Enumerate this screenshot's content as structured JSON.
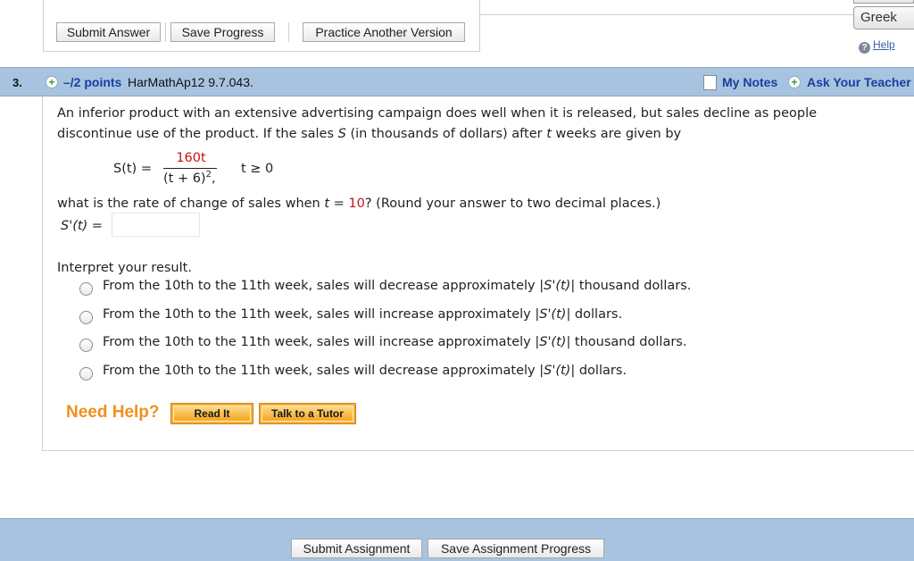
{
  "toolbar": {
    "submit_answer": "Submit Answer",
    "save_progress": "Save Progress",
    "practice_another": "Practice Another Version"
  },
  "language": {
    "selected": "Greek"
  },
  "help": {
    "label": "Help"
  },
  "question": {
    "number": "3.",
    "points": "–/2 points",
    "code": "HarMathAp12 9.7.043.",
    "my_notes": "My Notes",
    "ask_teacher": "Ask Your Teacher",
    "text_line1": "An inferior product with an extensive advertising campaign does well when it is released, but sales decline as people",
    "text_line2_a": "discontinue use of the product. If the sales ",
    "text_line2_S": "S",
    "text_line2_b": " (in thousands of dollars) after ",
    "text_line2_t": "t",
    "text_line2_c": " weeks are given by",
    "formula_lhs": "S(t)",
    "formula_eq": " =",
    "formula_num": "160t",
    "formula_den": "(t + 6)",
    "formula_den_exp": "2",
    "formula_comma": ",",
    "formula_cond": "t ≥ 0",
    "rate_a": "what is the rate of change of sales when ",
    "rate_t": "t",
    "rate_eq": " = ",
    "rate_val": "10",
    "rate_b": "? (Round your answer to two decimal places.)",
    "answer_label": "S'(t)",
    "answer_eq": " =",
    "answer_value": "",
    "interpret": "Interpret your result.",
    "options": [
      {
        "pre": "From the 10th to the 11th week, sales will decrease approximately |",
        "mid": "S'(t)",
        "post": "| thousand dollars."
      },
      {
        "pre": "From the 10th to the 11th week, sales will increase approximately |",
        "mid": "S'(t)",
        "post": "| dollars."
      },
      {
        "pre": "From the 10th to the 11th week, sales will increase approximately |",
        "mid": "S'(t)",
        "post": "| thousand dollars."
      },
      {
        "pre": "From the 10th to the 11th week, sales will decrease approximately |",
        "mid": "S'(t)",
        "post": "| dollars."
      }
    ]
  },
  "need_help": {
    "title": "Need Help?",
    "read_it": "Read It",
    "talk_tutor": "Talk to a Tutor"
  },
  "footer": {
    "submit_assignment": "Submit Assignment",
    "save_assignment": "Save Assignment Progress"
  },
  "colors": {
    "header_bar": "#a7c3df",
    "link_blue": "#1a3fa0",
    "need_help_orange": "#f0901f",
    "value_red": "#cc1111"
  }
}
